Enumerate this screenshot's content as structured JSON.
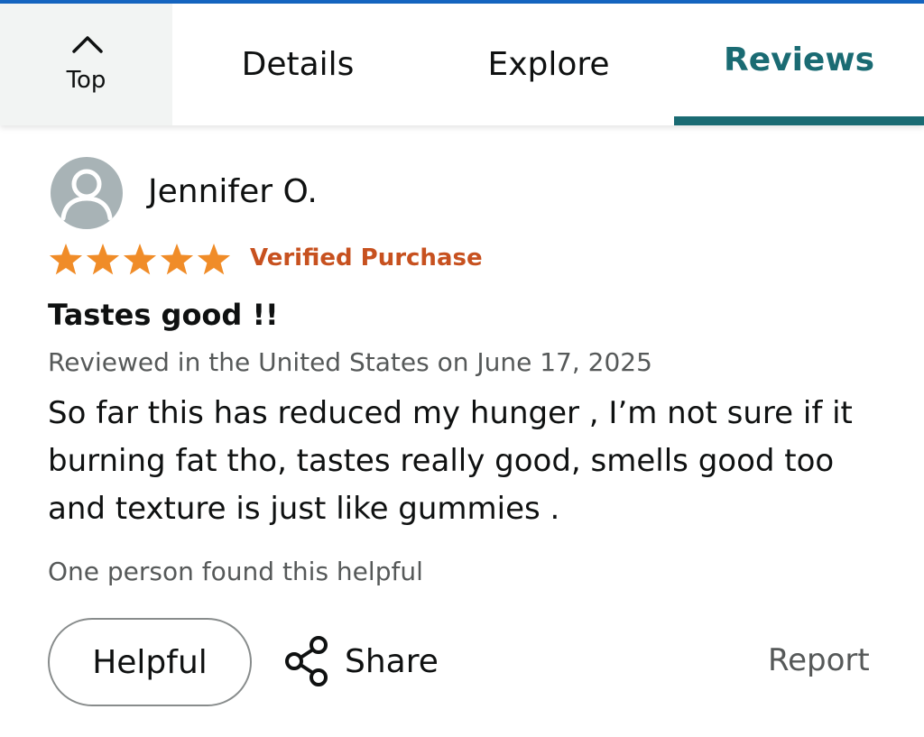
{
  "tabs": {
    "top_label": "Top",
    "details_label": "Details",
    "explore_label": "Explore",
    "reviews_label": "Reviews",
    "active": "Reviews"
  },
  "review": {
    "reviewer_name": "Jennifer O.",
    "rating": 5,
    "rating_max": 5,
    "verified_label": "Verified Purchase",
    "title": "Tastes good !!",
    "meta": "Reviewed in the United States on June 17, 2025",
    "body": "So far this has reduced my hunger , I’m not sure if it burning fat tho, tastes really good, smells good too and texture is just like gummies .",
    "helpful_count_text": "One person found this helpful",
    "helpful_button_label": "Helpful",
    "share_label": "Share",
    "report_label": "Report"
  },
  "icons": {
    "top": "chevron-up-icon",
    "avatar": "user-placeholder-icon",
    "star": "star-icon",
    "share": "share-icon"
  },
  "colors": {
    "accent_teal": "#1a6b73",
    "star_orange": "#f08c28",
    "verified_orange": "#c7511f",
    "secondary_text": "#565959",
    "top_bar_blue": "#1565c0"
  }
}
